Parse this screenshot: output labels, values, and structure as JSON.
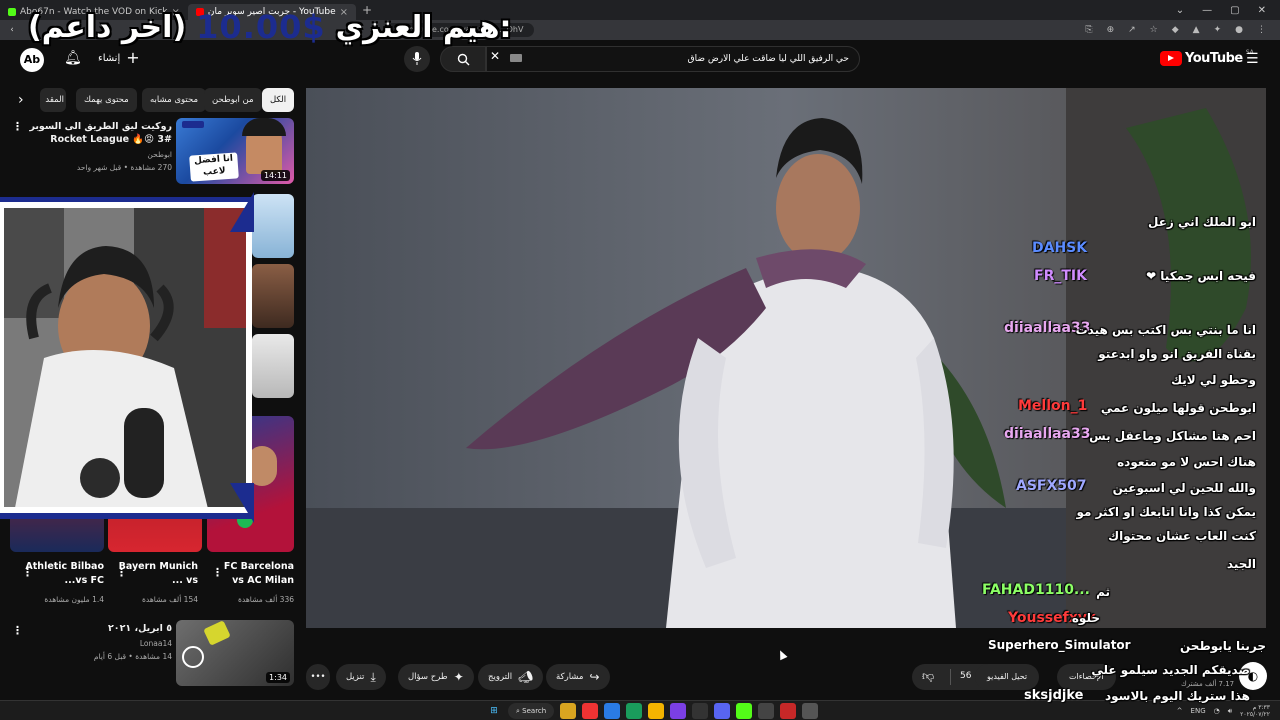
{
  "browser": {
    "tabs": [
      {
        "label": "Abo67n - Watch the VOD on Kick",
        "active": false,
        "color": "#53fc18"
      },
      {
        "label": "جربت اصير سوبر مان - YouTube",
        "active": true,
        "color": "#ff0000"
      }
    ],
    "url": "youtube.com/watch?v=...OhV",
    "back": "‹"
  },
  "overlay": {
    "donor": "هيم العنزي:",
    "amount": "10.00$",
    "message": "(اخر داعم)"
  },
  "masthead": {
    "avatar_text": "Ab",
    "create_label": "إنشاء",
    "search_query": "حي الرفيق اللي ليا ضاقت علي الارض ضاق",
    "logo_text": "YouTube",
    "region": "SA"
  },
  "chips": [
    {
      "label": "الكل",
      "active": true
    },
    {
      "label": "من ابوطحن",
      "active": false
    },
    {
      "label": "محتوى مشابه",
      "active": false
    },
    {
      "label": "محتوى يهمك",
      "active": false
    },
    {
      "label": "المقد",
      "active": false
    }
  ],
  "recommendations": [
    {
      "title": "روكيت ليق الطريق الى السوبر #3 😡🔥 Rocket League",
      "channel": "ابوطحن",
      "meta": "270 مشاهدة • قبل شهر واحد",
      "duration": "14:11",
      "thumb_caption": "انا افضل لاعب"
    },
    {
      "title": "٥ ابريل، ٢٠٢١",
      "channel": "Lonaa14",
      "meta": "14 مشاهدة • قبل 6 أيام",
      "duration": "1:34"
    }
  ],
  "shorts": [
    {
      "title": "FC Barcelona vs AC Milan",
      "meta": "336 ألف مشاهدة"
    },
    {
      "title": "Bayern Munich vs ...",
      "meta": "154 ألف مشاهدة"
    },
    {
      "title": "Athletic Bilbao vs FC...",
      "meta": "1.4 مليون مشاهدة"
    }
  ],
  "chat": [
    {
      "name": "DAHSK",
      "color": "#5b8cff",
      "text": "ابو الملك اني زعل"
    },
    {
      "name": "FR_TIK",
      "color": "#d08cff",
      "text": "فيحه ابس جمكيا ❤"
    },
    {
      "name": "diiaallaa33",
      "color": "#e8a8f0",
      "text": "انا ما بنتي بس اكتب بس هيدت"
    },
    {
      "name": "",
      "color": "#ffffff",
      "text": "بقناة الفريق انو واو ابدعتو"
    },
    {
      "name": "",
      "color": "#ffffff",
      "text": "وحطو لي لايك"
    },
    {
      "name": "Mellon_1",
      "color": "#ff3b3b",
      "text": "ابوطحن قولها ميلون عمي"
    },
    {
      "name": "diiaallaa33",
      "color": "#e8a8f0",
      "text": "احم هنا مشاكل وماعقل بس"
    },
    {
      "name": "",
      "color": "#ffffff",
      "text": "هناك احس لا مو متعوده"
    },
    {
      "name": "ASFX507",
      "color": "#9fa8ff",
      "text": "والله للحين لي اسبوعين"
    },
    {
      "name": "",
      "color": "#ffffff",
      "text": "يمكن كذا وانا اتابعك او اكثر مو"
    },
    {
      "name": "",
      "color": "#ffffff",
      "text": "كنت العاب عشان محتواك"
    },
    {
      "name": "",
      "color": "#ffffff",
      "text": "الجيد"
    },
    {
      "name": "FAHAD1110...",
      "color": "#8cff66",
      "text": "ثم"
    },
    {
      "name": "Youssefxyx",
      "color": "#ff3b3b",
      "text": "حلوه"
    },
    {
      "name": "Superhero_Simulator",
      "color": "#ffffff",
      "text": "جربنا يابوطحن"
    },
    {
      "name": "",
      "color": "#ffffff",
      "text": "صديقكم الجديد سيلمو علي"
    },
    {
      "name": "sksjdjke",
      "color": "#ffffff",
      "text": "هذا ستريك اليوم بالاسود"
    }
  ],
  "actions": {
    "like_count": "56",
    "share": "مشاركة",
    "promote": "الترويج",
    "ask": "طرح سؤال",
    "download": "تنزيل",
    "more": "•••"
  },
  "owner": {
    "edit_video": "تحيل الفيديو",
    "stats": "الإحصاءات",
    "subscribers": "7.17 ألف مشترك"
  },
  "taskbar": {
    "search": "Search",
    "time": "٣:٣٣ م",
    "date": "٢٠٢٥/٠٧/٢٢",
    "lang": "ENG"
  }
}
